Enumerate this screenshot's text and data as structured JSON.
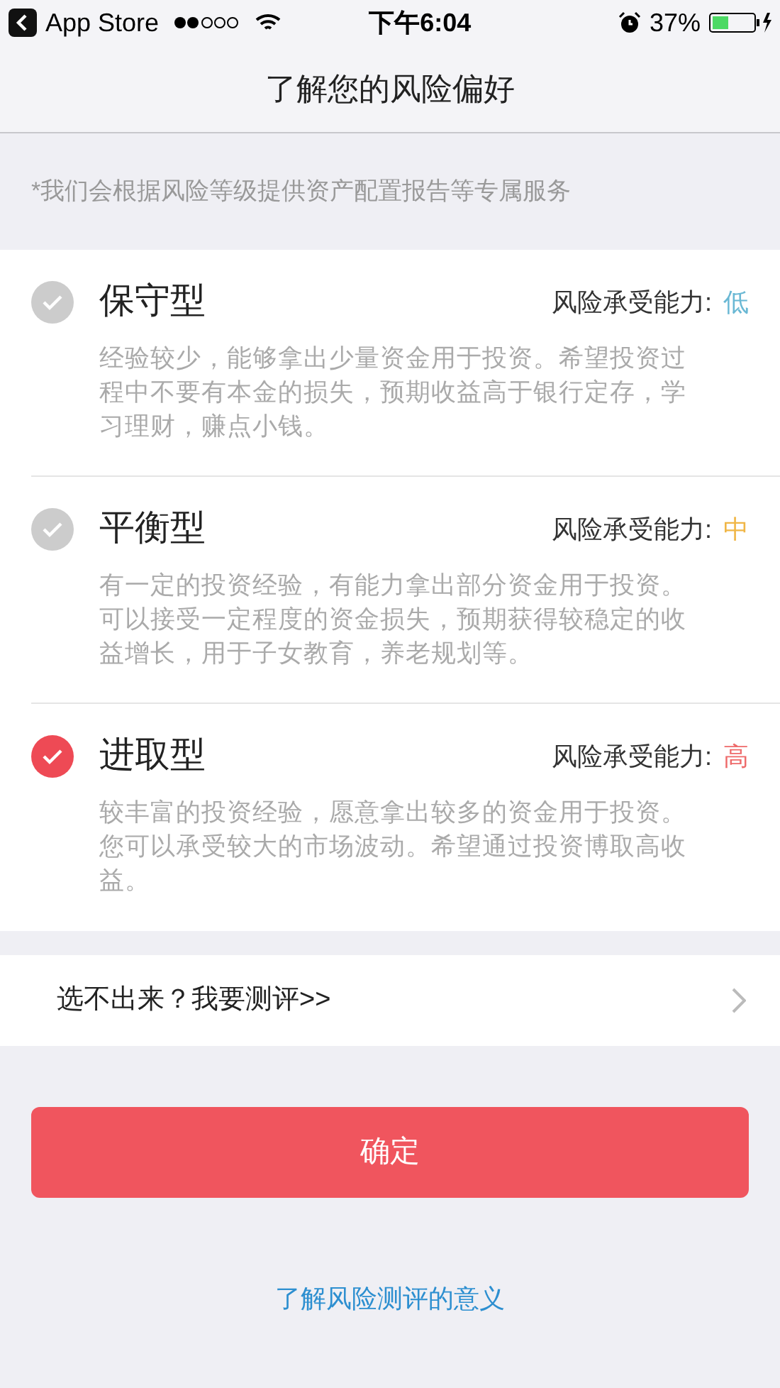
{
  "status_bar": {
    "back_app": "App Store",
    "time": "下午6:04",
    "battery": "37%"
  },
  "nav": {
    "title": "了解您的风险偏好"
  },
  "note": "*我们会根据风险等级提供资产配置报告等专属服务",
  "options": [
    {
      "title": "保守型",
      "risk_label": "风险承受能力:",
      "risk_level": "低",
      "color": "#6ab8d4",
      "selected": false,
      "description": "经验较少，能够拿出少量资金用于投资。希望投资过程中不要有本金的损失，预期收益高于银行定存，学习理财，赚点小钱。"
    },
    {
      "title": "平衡型",
      "risk_label": "风险承受能力:",
      "risk_level": "中",
      "color": "#f0b646",
      "selected": false,
      "description": "有一定的投资经验，有能力拿出部分资金用于投资。可以接受一定程度的资金损失，预期获得较稳定的收益增长，用于子女教育，养老规划等。"
    },
    {
      "title": "进取型",
      "risk_label": "风险承受能力:",
      "risk_level": "高",
      "color": "#ee6a6a",
      "selected": true,
      "description": "较丰富的投资经验，愿意拿出较多的资金用于投资。您可以承受较大的市场波动。希望通过投资博取高收益。"
    }
  ],
  "assessment_row": {
    "label": "选不出来？我要测评>>"
  },
  "confirm_button": "确定",
  "footer_link": "了解风险测评的意义"
}
